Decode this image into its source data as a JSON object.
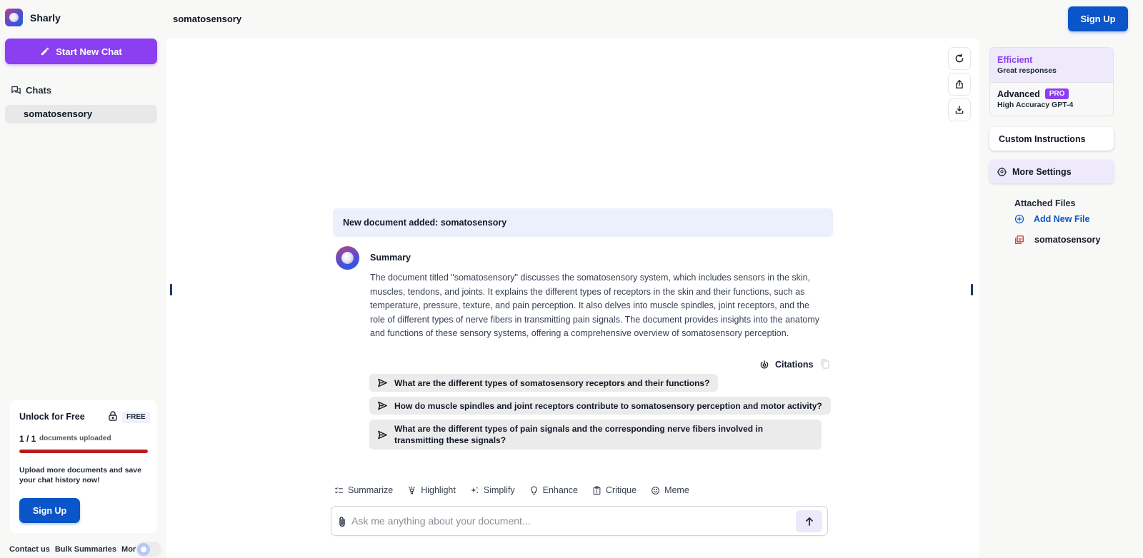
{
  "app": {
    "name": "Sharly",
    "document_title": "somatosensory"
  },
  "sidebar": {
    "new_chat_label": "Start New Chat",
    "chats_heading": "Chats",
    "chats": [
      {
        "label": "somatosensory",
        "active": true
      }
    ],
    "unlock": {
      "title": "Unlock for Free",
      "badge": "FREE",
      "doc_count": "1 / 1",
      "doc_label": "documents uploaded",
      "progress_percent": 100,
      "progress_color": "#b91c1c",
      "message": "Upload more documents and save your chat history now!",
      "signup_label": "Sign Up"
    },
    "footer_links": [
      "Contact us",
      "Bulk Summaries",
      "More"
    ],
    "theme_toggle": "light"
  },
  "header": {
    "signup_label": "Sign Up"
  },
  "main": {
    "actions": [
      "refresh-icon",
      "share-icon",
      "download-icon"
    ],
    "doc_added_message": "New document added: somatosensory",
    "summary": {
      "label": "Summary",
      "text": "The document titled \"somatosensory\" discusses the somatosensory system, which includes sensors in the skin, muscles, tendons, and joints. It explains the different types of receptors in the skin and their functions, such as temperature, pressure, texture, and pain perception. It also delves into muscle spindles, joint receptors, and the role of different types of nerve fibers in transmitting pain signals. The document provides insights into the anatomy and functions of these sensory systems, offering a comprehensive overview of somatosensory perception.",
      "citations_label": "Citations"
    },
    "suggestions": [
      "What are the different types of somatosensory receptors and their functions?",
      "How do muscle spindles and joint receptors contribute to somatosensory perception and motor activity?",
      "What are the different types of pain signals and the corresponding nerve fibers involved in transmitting these signals?"
    ],
    "tools": [
      {
        "label": "Summarize",
        "icon": "checklist-icon"
      },
      {
        "label": "Highlight",
        "icon": "highlight-icon"
      },
      {
        "label": "Simplify",
        "icon": "sparkle-icon"
      },
      {
        "label": "Enhance",
        "icon": "lightbulb-icon"
      },
      {
        "label": "Critique",
        "icon": "clipboard-alert-icon"
      },
      {
        "label": "Meme",
        "icon": "smiley-icon"
      }
    ],
    "input": {
      "value": "",
      "placeholder": "Ask me anything about your document..."
    }
  },
  "right_panel": {
    "models": [
      {
        "name": "Efficient",
        "desc": "Great responses",
        "selected": true
      },
      {
        "name": "Advanced",
        "badge": "PRO",
        "desc": "High Accuracy GPT-4",
        "selected": false
      }
    ],
    "custom_instructions_label": "Custom Instructions",
    "more_settings_label": "More Settings",
    "attached_heading": "Attached Files",
    "add_file_label": "Add New File",
    "files": [
      {
        "name": "somatosensory",
        "type": "pdf"
      }
    ]
  },
  "colors": {
    "accent_purple": "#8b3ff0",
    "brand_blue": "#0a55c7",
    "progress_red": "#b91c1c"
  }
}
